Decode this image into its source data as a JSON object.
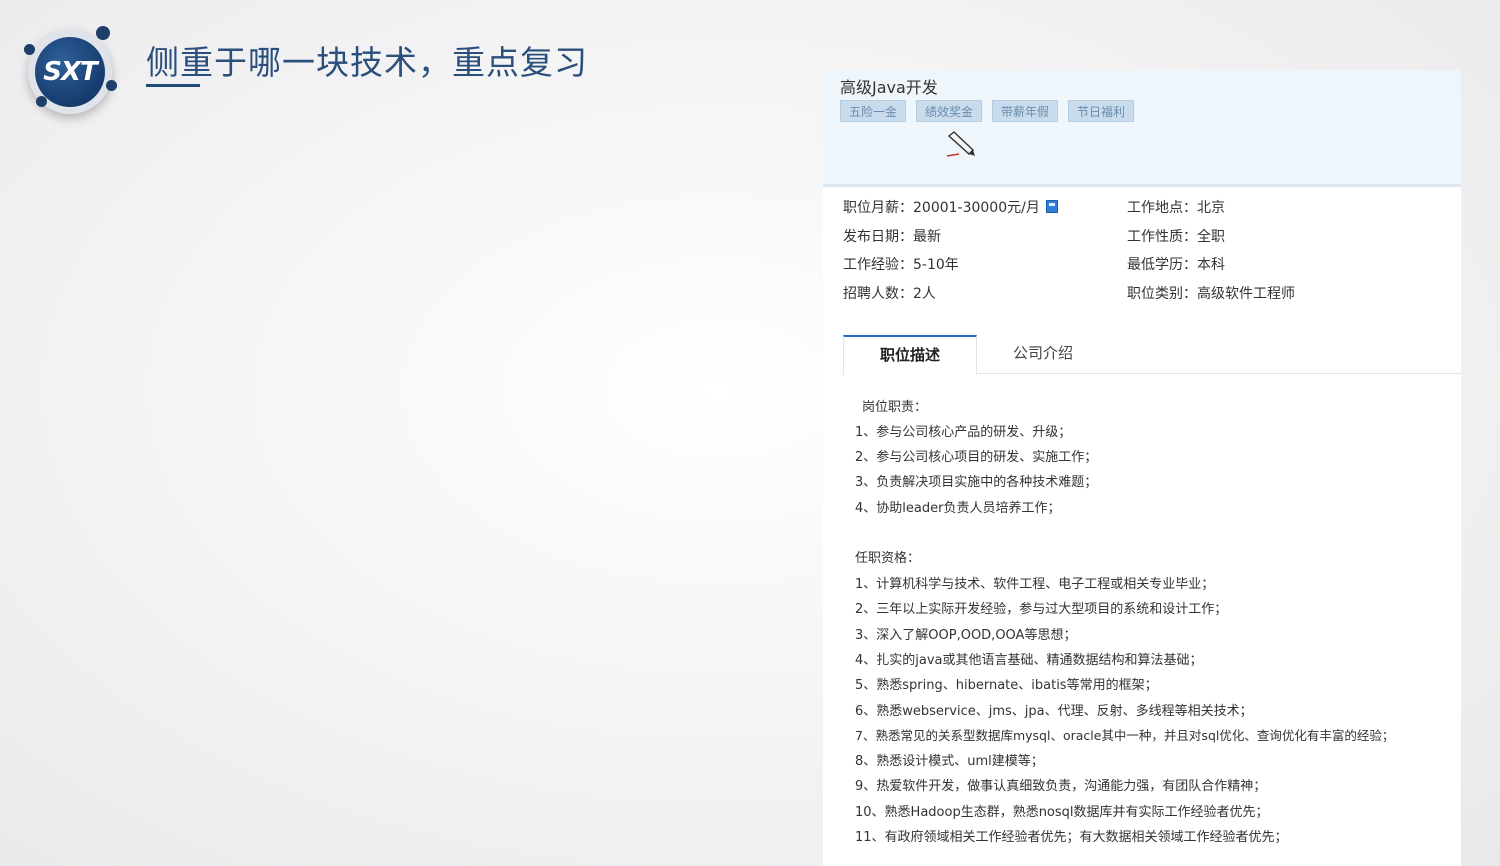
{
  "slide": {
    "title": "侧重于哪一块技术，重点复习",
    "logo_text": "SXT"
  },
  "job": {
    "title": "高级Java开发",
    "tags": [
      "五险一金",
      "绩效奖金",
      "带薪年假",
      "节日福利"
    ],
    "info": {
      "salary": "职位月薪：20001-30000元/月",
      "location": "工作地点：北京",
      "date": "发布日期：最新",
      "type": "工作性质：全职",
      "experience": "工作经验：5-10年",
      "education": "最低学历：本科",
      "headcount": "招聘人数：2人",
      "category": "职位类别：高级软件工程师"
    },
    "tabs": {
      "active": "职位描述",
      "inactive": "公司介绍"
    },
    "description": {
      "duties_heading": "岗位职责：",
      "duties": [
        "1、参与公司核心产品的研发、升级；",
        "2、参与公司核心项目的研发、实施工作；",
        "3、负责解决项目实施中的各种技术难题；",
        "4、协助leader负责人员培养工作；"
      ],
      "req_heading": "任职资格：",
      "requirements": [
        "1、计算机科学与技术、软件工程、电子工程或相关专业毕业；",
        "2、三年以上实际开发经验，参与过大型项目的系统和设计工作；",
        "3、深入了解OOP,OOD,OOA等思想；",
        "4、扎实的java或其他语言基础、精通数据结构和算法基础；",
        "5、熟悉spring、hibernate、ibatis等常用的框架；",
        "6、熟悉webservice、jms、jpa、代理、反射、多线程等相关技术；",
        "7、熟悉常见的关系型数据库mysql、oracle其中一种，并且对sql优化、查询优化有丰富的经验；",
        "8、熟悉设计模式、uml建模等；",
        "9、热爱软件开发，做事认真细致负责，沟通能力强，有团队合作精神；",
        "10、熟悉Hadoop生态群，熟悉nosql数据库并有实际工作经验者优先；",
        "11、有政府领域相关工作经验者优先；有大数据相关领域工作经验者优先；"
      ]
    }
  },
  "icons": {
    "calculator": "calculator-icon",
    "cursor": "pen-cursor-icon"
  }
}
